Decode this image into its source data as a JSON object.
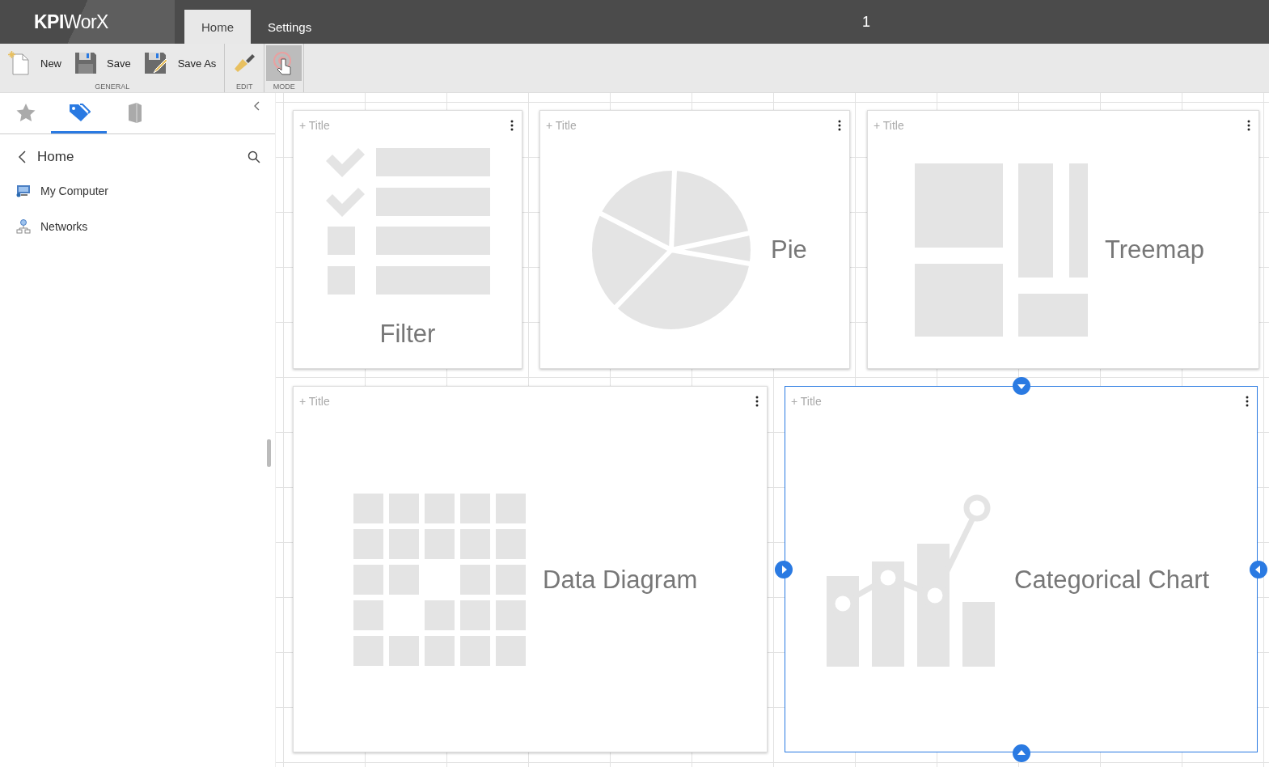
{
  "app": {
    "logo_bold": "KPI",
    "logo_rest": "WorX",
    "page_indicator": "1"
  },
  "menu_tabs": [
    {
      "label": "Home",
      "selected": true
    },
    {
      "label": "Settings",
      "selected": false
    }
  ],
  "ribbon_groups": [
    {
      "label": "GENERAL",
      "buttons": [
        {
          "kind": "new",
          "label": "New",
          "pressed": false
        },
        {
          "kind": "save",
          "label": "Save",
          "pressed": false
        },
        {
          "kind": "save-as",
          "label": "Save As",
          "pressed": false
        }
      ]
    },
    {
      "label": "EDIT",
      "buttons": [
        {
          "kind": "edit",
          "pressed": false
        }
      ]
    },
    {
      "label": "MODE",
      "buttons": [
        {
          "kind": "mode",
          "pressed": true
        }
      ]
    }
  ],
  "sidebar": {
    "tabs": [
      {
        "kind": "star",
        "selected": false
      },
      {
        "kind": "tags",
        "selected": true
      },
      {
        "kind": "book",
        "selected": false
      }
    ],
    "path": "Home",
    "items": [
      {
        "kind": "computer",
        "label": "My Computer"
      },
      {
        "kind": "network",
        "label": "Networks"
      }
    ]
  },
  "cards": [
    {
      "kind": "filter",
      "title_placeholder": "+ Title",
      "label": "Filter",
      "selected": false
    },
    {
      "kind": "pie",
      "title_placeholder": "+ Title",
      "label": "Pie",
      "selected": false
    },
    {
      "kind": "treemap",
      "title_placeholder": "+ Title",
      "label": "Treemap",
      "selected": false
    },
    {
      "kind": "grid",
      "title_placeholder": "+ Title",
      "label": "Data Diagram",
      "selected": false
    },
    {
      "kind": "chart",
      "title_placeholder": "+ Title",
      "label": "Categorical Chart",
      "selected": true
    }
  ]
}
